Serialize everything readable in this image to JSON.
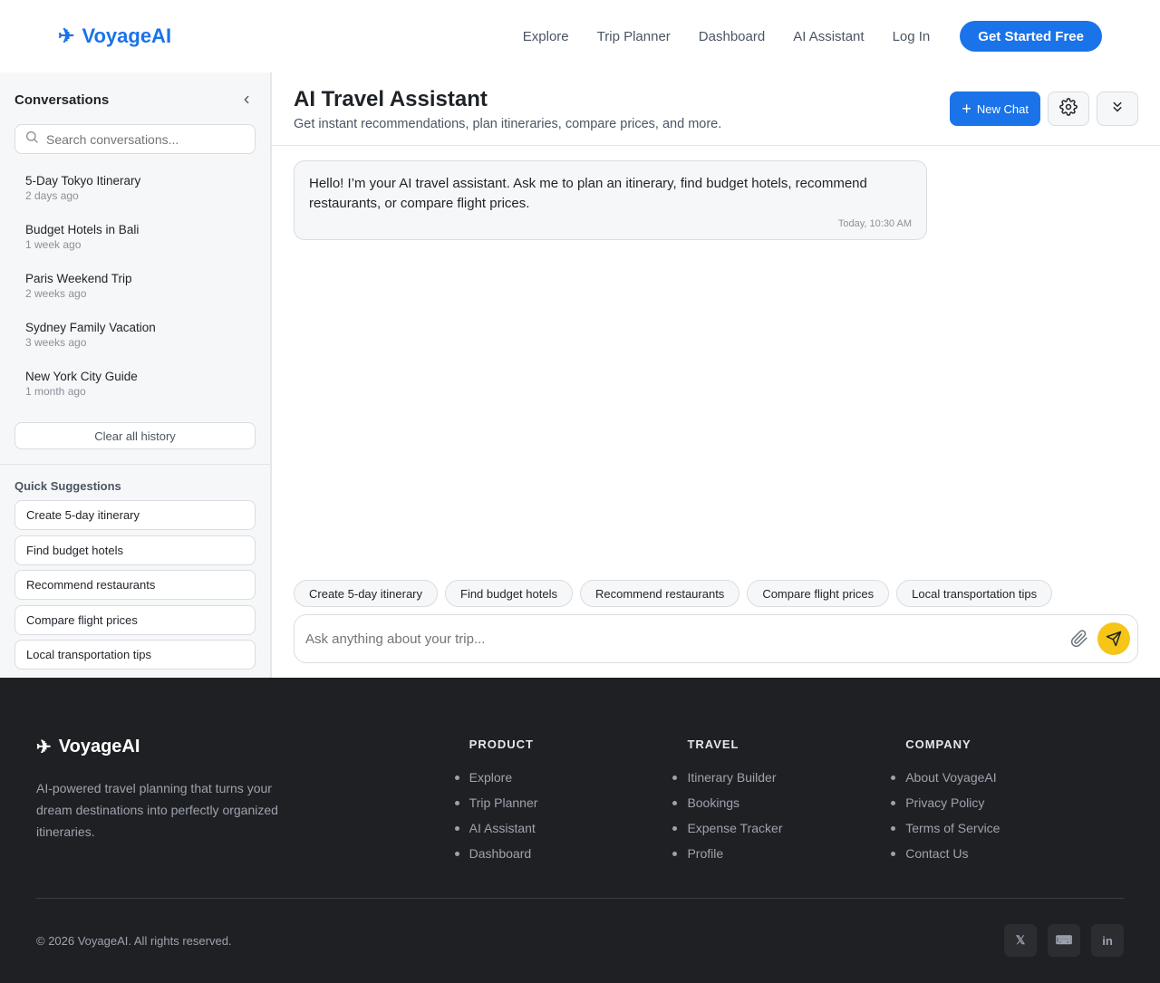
{
  "header": {
    "brand_icon": "plane-icon",
    "brand": "VoyageAI",
    "nav": [
      "Explore",
      "Trip Planner",
      "Dashboard",
      "AI Assistant",
      "Log In"
    ],
    "cta": "Get Started Free",
    "accent": "#1a73e8"
  },
  "sidebar": {
    "title": "Conversations",
    "collapse_icon": "chevron-left-icon",
    "search_placeholder": "Search conversations...",
    "conversations": [
      {
        "title": "5-Day Tokyo Itinerary",
        "time": "2 days ago"
      },
      {
        "title": "Budget Hotels in Bali",
        "time": "1 week ago"
      },
      {
        "title": "Paris Weekend Trip",
        "time": "2 weeks ago"
      },
      {
        "title": "Sydney Family Vacation",
        "time": "3 weeks ago"
      },
      {
        "title": "New York City Guide",
        "time": "1 month ago"
      }
    ],
    "clear_label": "Clear all history",
    "suggestions_title": "Quick Suggestions",
    "suggestions": [
      "Create 5-day itinerary",
      "Find budget hotels",
      "Recommend restaurants",
      "Compare flight prices",
      "Local transportation tips"
    ]
  },
  "main": {
    "title": "AI Travel Assistant",
    "subtitle": "Get instant recommendations, plan itineraries, compare prices, and more.",
    "new_chat": "New Chat",
    "message": {
      "text": "Hello! I’m your AI travel assistant. Ask me to plan an itinerary, find budget hotels, recommend restaurants, or compare flight prices.",
      "time": "Today, 10:30 AM"
    },
    "chips": [
      "Create 5-day itinerary",
      "Find budget hotels",
      "Recommend restaurants",
      "Compare flight prices",
      "Local transportation tips"
    ],
    "input_placeholder": "Ask anything about your trip...",
    "send_color": "#f5c518"
  },
  "footer": {
    "brand": "VoyageAI",
    "description": "AI-powered travel planning that turns your dream destinations into perfectly organized itineraries.",
    "columns": [
      {
        "heading": "PRODUCT",
        "links": [
          "Explore",
          "Trip Planner",
          "AI Assistant",
          "Dashboard"
        ]
      },
      {
        "heading": "TRAVEL",
        "links": [
          "Itinerary Builder",
          "Bookings",
          "Expense Tracker",
          "Profile"
        ]
      },
      {
        "heading": "COMPANY",
        "links": [
          "About VoyageAI",
          "Privacy Policy",
          "Terms of Service",
          "Contact Us"
        ]
      }
    ],
    "copyright": "© 2026 VoyageAI. All rights reserved.",
    "socials": [
      "𝕏",
      "⌨",
      "in"
    ]
  }
}
